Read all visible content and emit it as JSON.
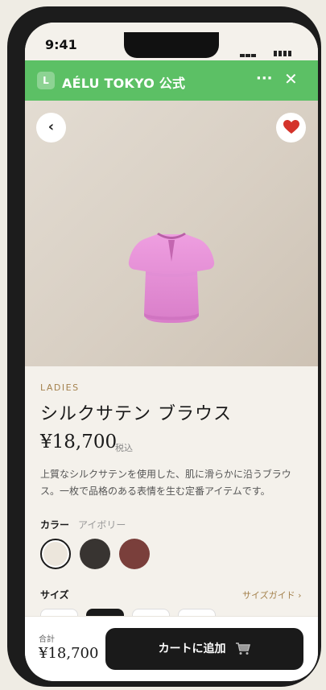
{
  "status": {
    "time": "9:41"
  },
  "line_header": {
    "logo": "L",
    "title": "AÉLU TOKYO 公式",
    "more": "···",
    "close": "✕"
  },
  "hero": {
    "back": "‹",
    "favorite_icon": "heart-icon",
    "favorite_color": "#d4332b"
  },
  "product": {
    "category": "LADIES",
    "title": "シルクサテン ブラウス",
    "price": "¥18,700",
    "tax_label": "税込",
    "description": "上質なシルクサテンを使用した、肌に滑らかに沿うブラウス。一枚で品格のある表情を生む定番アイテムです。"
  },
  "color": {
    "label": "カラー",
    "selected": "アイボリー",
    "swatches": [
      "#ece6dc",
      "#383431",
      "#7a3f3b"
    ]
  },
  "size": {
    "label": "サイズ",
    "guide": "サイズガイド ›"
  },
  "bottom": {
    "total_label": "合計",
    "total_value": "¥18,700",
    "cart_label": "カートに追加"
  },
  "theme": {
    "line_green": "#5cc065",
    "accent_gold": "#a4824e",
    "button_dark": "#1a1a1a"
  }
}
